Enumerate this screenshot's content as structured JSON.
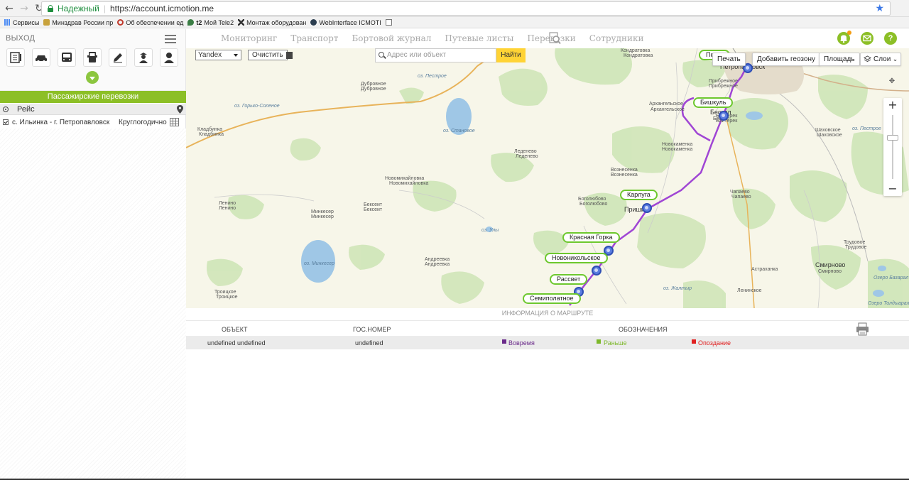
{
  "browser": {
    "secure_label": "Надежный",
    "url": "https://account.icmotion.me",
    "bookmarks": [
      "Сервисы",
      "Минздрав России пр",
      "Об обеспечении ед",
      "Мой Tele2",
      "Монтаж оборудован",
      "WebInterface ICMOTI"
    ]
  },
  "sidebar": {
    "exit_label": "ВЫХОД",
    "icons": [
      "list-icon",
      "car-icon",
      "bus-icon",
      "truck-icon",
      "edit-icon",
      "driver-icon",
      "user-icon"
    ],
    "section_title": "Пассажирские перевозки",
    "reis_label": "Рейс",
    "route": {
      "name": "с. Ильинка - г. Петропавловск",
      "schedule": "Круглогодично"
    }
  },
  "topnav": {
    "items": [
      "Мониторинг",
      "Транспорт",
      "Бортовой журнал",
      "Путевые листы",
      "Перевозки",
      "Сотрудники"
    ],
    "colors": {
      "accent": "#8cbf26",
      "badge": "#f39c12"
    }
  },
  "map": {
    "provider": "Yandex",
    "clear_label": "Очистить",
    "search_placeholder": "Адрес или объект",
    "find_label": "Найти",
    "print_label": "Печать",
    "geozone_label": "Добавить геозону",
    "area_label": "Площадь",
    "layers_label": "Слои",
    "route_color": "#a046d4",
    "stops": [
      "Пет…",
      "Бишкуль",
      "Карлуга",
      "Красная Горка",
      "Новоникольское",
      "Рассвет",
      "Семиполатное"
    ],
    "places": {
      "kondratovka": "Кондратовка",
      "kondratovka2": "Кондратовка",
      "pribrezhnoe": "Прибрежное",
      "pribrezhnoe2": "Прибрежное",
      "arkh": "Архангельское",
      "arkh2": "Архангельское",
      "dubrovnoe": "Дубровное",
      "dubrovnoe2": "Дубровное",
      "gorko": "оз. Горько-Соленое",
      "pestroe": "оз. Пестрое",
      "stanovoe": "оз. Становое",
      "kladbinka": "Кладбинка",
      "kladbinka2": "Кладбинка",
      "ledenevo": "Леденево",
      "ledenevo2": "Леденево",
      "novomikh": "Новомихайловка",
      "novomikh2": "Новомихайловка",
      "bekseit": "Бексеит",
      "bekseit2": "Бексеит",
      "minkeser": "Минкесер",
      "minkeser2": "Минкесер",
      "lenino": "Ленино",
      "lenino2": "Ленино",
      "ozminkeser": "оз. Минкесер",
      "ulyu": "оз. Улы",
      "andreevka": "Андреевка",
      "andreevka2": "Андреевка",
      "troitskoe": "Троицкое",
      "troitskoe2": "Троицкое",
      "voznes": "Вознесенка",
      "voznes2": "Вознесенка",
      "bogolyub": "Боголюбово",
      "bogolyub2": "Боголюбово",
      "prishim": "Пришим",
      "novokam": "Новокаменка",
      "novokam2": "Новокаменка",
      "bayterek": "Байтерек",
      "bayterek2": "Байтерек",
      "beskol": "Бескол",
      "beskol2": "Бескол",
      "petropav": "Петропавловск",
      "shakh": "Шаховское",
      "shakh2": "Шаховское",
      "pestroe2": "оз. Пестрое",
      "chapaevo": "Чапаево",
      "chapaevo2": "Чапаево",
      "trudovoe": "Трудовое",
      "trudovoe2": "Трудовое",
      "smirnovo": "Смирново",
      "smirnovo2": "Смирново",
      "astrakh": "Астраханка",
      "leninskoe": "Ленинское",
      "zhaltyr": "оз. Жалтыр",
      "bozaral": "Озеро Базарал",
      "toldyaral": "Озеро Толдыарал"
    }
  },
  "route_info": {
    "title": "ИНФОРМАЦИЯ О МАРШРУТЕ",
    "headers": {
      "object": "ОБЪЕКТ",
      "plate": "ГОС.НОМЕР",
      "legend": "ОБОЗНАЧЕНИЯ"
    },
    "row": {
      "object": "undefined undefined",
      "plate": "undefined"
    },
    "legend": [
      {
        "label": "Вовремя",
        "color": "#6a2a8a"
      },
      {
        "label": "Раньше",
        "color": "#7db82a"
      },
      {
        "label": "Опоздание",
        "color": "#e02020"
      }
    ]
  }
}
